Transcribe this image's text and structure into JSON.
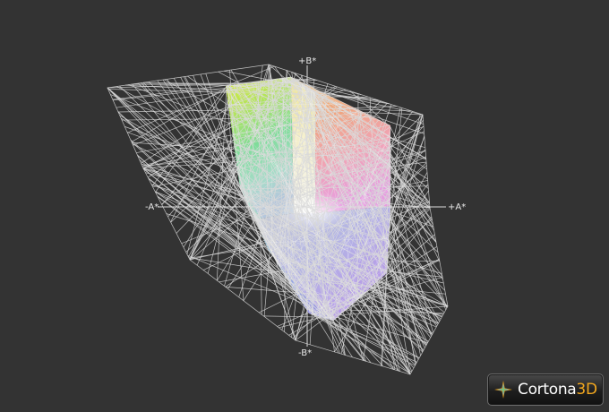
{
  "viewer": {
    "background_color": "#333333",
    "wireframe_color": "#d8d8d8"
  },
  "axes": {
    "b_plus": "+B*",
    "b_minus": "-B*",
    "a_plus": "+A*",
    "a_minus": "-A*"
  },
  "logo": {
    "icon": "cortona-star-icon",
    "name": "Cortona",
    "accent": "3D",
    "accent_color": "#f2a71e"
  }
}
